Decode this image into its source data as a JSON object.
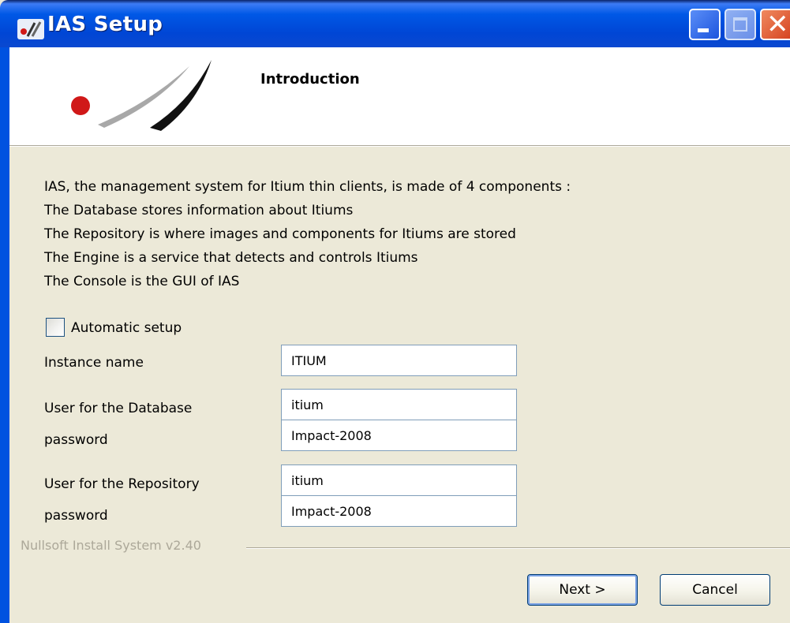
{
  "window": {
    "title": "IAS Setup",
    "title_icon": "nsis-app-icon"
  },
  "header": {
    "page_title": "Introduction",
    "logo": "ias-logo"
  },
  "description": {
    "lines": [
      "IAS, the management system for Itium thin clients, is made of 4 components :",
      "The Database stores information about Itiums",
      "The Repository is where images and components for Itiums are stored",
      "The Engine is a service that detects and controls Itiums",
      "The Console is the GUI of IAS"
    ]
  },
  "form": {
    "automatic_setup": {
      "label": "Automatic setup",
      "checked": false
    },
    "instance_name": {
      "label": "Instance name",
      "value": "ITIUM"
    },
    "db_user": {
      "label": "User for the Database",
      "value": "itium"
    },
    "db_password": {
      "label": "password",
      "value": "Impact-2008"
    },
    "repo_user": {
      "label": "User for the Repository",
      "value": "itium"
    },
    "repo_password": {
      "label": "password",
      "value": "Impact-2008"
    }
  },
  "branding": "Nullsoft Install System v2.40",
  "buttons": {
    "next": "Next >",
    "cancel": "Cancel"
  },
  "colors": {
    "titlebar": "#0058e6",
    "dialog_bg": "#ECE9D8",
    "logo_red": "#d01818"
  }
}
